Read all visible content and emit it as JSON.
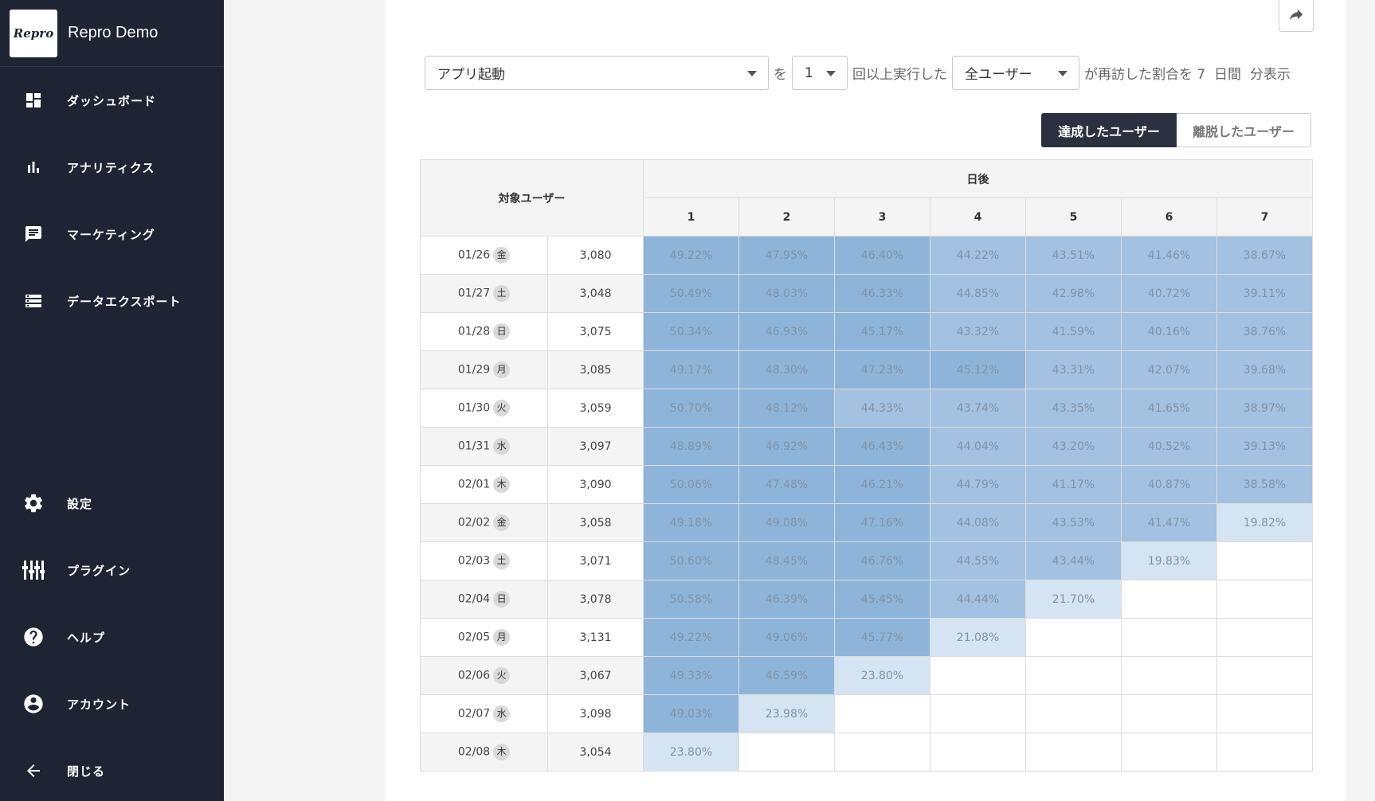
{
  "app": {
    "logo_text": "Repro",
    "name": "Repro Demo"
  },
  "nav_top": [
    {
      "label": "ダッシュボード",
      "icon": "dashboard-icon"
    },
    {
      "label": "アナリティクス",
      "icon": "bar-chart-icon"
    },
    {
      "label": "マーケティング",
      "icon": "chat-icon"
    },
    {
      "label": "データエクスポート",
      "icon": "storage-icon"
    }
  ],
  "nav_bottom": [
    {
      "label": "設定",
      "icon": "gear-icon"
    },
    {
      "label": "プラグイン",
      "icon": "equalizer-icon"
    },
    {
      "label": "ヘルプ",
      "icon": "help-icon"
    },
    {
      "label": "アカウント",
      "icon": "account-icon"
    },
    {
      "label": "閉じる",
      "icon": "arrow-left-icon"
    }
  ],
  "filter": {
    "event": "アプリ起動",
    "text_wo": "を",
    "times": "1",
    "text_exec": "回以上実行した",
    "segment": "全ユーザー",
    "text_suffix": "が再訪した割合を 7  日間  分表示"
  },
  "toggle": {
    "active": "達成したユーザー",
    "inactive": "離脱したユーザー"
  },
  "table": {
    "header_target": "対象ユーザー",
    "header_days": "日後",
    "day_numbers": [
      "1",
      "2",
      "3",
      "4",
      "5",
      "6",
      "7"
    ],
    "rows": [
      {
        "date": "01/26",
        "dow": "金",
        "count": "3,080",
        "values": [
          "49.22%",
          "47.95%",
          "46.40%",
          "44.22%",
          "43.51%",
          "41.46%",
          "38.67%"
        ]
      },
      {
        "date": "01/27",
        "dow": "土",
        "count": "3,048",
        "values": [
          "50.49%",
          "48.03%",
          "46.33%",
          "44.85%",
          "42.98%",
          "40.72%",
          "39.11%"
        ]
      },
      {
        "date": "01/28",
        "dow": "日",
        "count": "3,075",
        "values": [
          "50.34%",
          "46.93%",
          "45.17%",
          "43.32%",
          "41.59%",
          "40.16%",
          "38.76%"
        ]
      },
      {
        "date": "01/29",
        "dow": "月",
        "count": "3,085",
        "values": [
          "49.17%",
          "48.30%",
          "47.23%",
          "45.12%",
          "43.31%",
          "42.07%",
          "39.68%"
        ]
      },
      {
        "date": "01/30",
        "dow": "火",
        "count": "3,059",
        "values": [
          "50.70%",
          "48.12%",
          "44.33%",
          "43.74%",
          "43.35%",
          "41.65%",
          "38.97%"
        ]
      },
      {
        "date": "01/31",
        "dow": "水",
        "count": "3,097",
        "values": [
          "48.89%",
          "46.92%",
          "46.43%",
          "44.04%",
          "43.20%",
          "40.52%",
          "39.13%"
        ]
      },
      {
        "date": "02/01",
        "dow": "木",
        "count": "3,090",
        "values": [
          "50.06%",
          "47.48%",
          "46.21%",
          "44.79%",
          "41.17%",
          "40.87%",
          "38.58%"
        ]
      },
      {
        "date": "02/02",
        "dow": "金",
        "count": "3,058",
        "values": [
          "49.18%",
          "49.08%",
          "47.16%",
          "44.08%",
          "43.53%",
          "41.47%",
          "19.82%"
        ]
      },
      {
        "date": "02/03",
        "dow": "土",
        "count": "3,071",
        "values": [
          "50.60%",
          "48.45%",
          "46.76%",
          "44.55%",
          "43.44%",
          "19.83%"
        ]
      },
      {
        "date": "02/04",
        "dow": "日",
        "count": "3,078",
        "values": [
          "50.58%",
          "46.39%",
          "45.45%",
          "44.44%",
          "21.70%"
        ]
      },
      {
        "date": "02/05",
        "dow": "月",
        "count": "3,131",
        "values": [
          "49.22%",
          "49.06%",
          "45.77%",
          "21.08%"
        ]
      },
      {
        "date": "02/06",
        "dow": "火",
        "count": "3,067",
        "values": [
          "49.33%",
          "46.59%",
          "23.80%"
        ]
      },
      {
        "date": "02/07",
        "dow": "水",
        "count": "3,098",
        "values": [
          "49.03%",
          "23.98%"
        ]
      },
      {
        "date": "02/08",
        "dow": "木",
        "count": "3,054",
        "values": [
          "23.80%"
        ]
      }
    ]
  },
  "colors": {
    "sidebar_bg": "#1e2433",
    "cell_dark": "#8fb4da",
    "cell_mid": "#a3c1e0",
    "cell_light": "#d5e4f2"
  }
}
